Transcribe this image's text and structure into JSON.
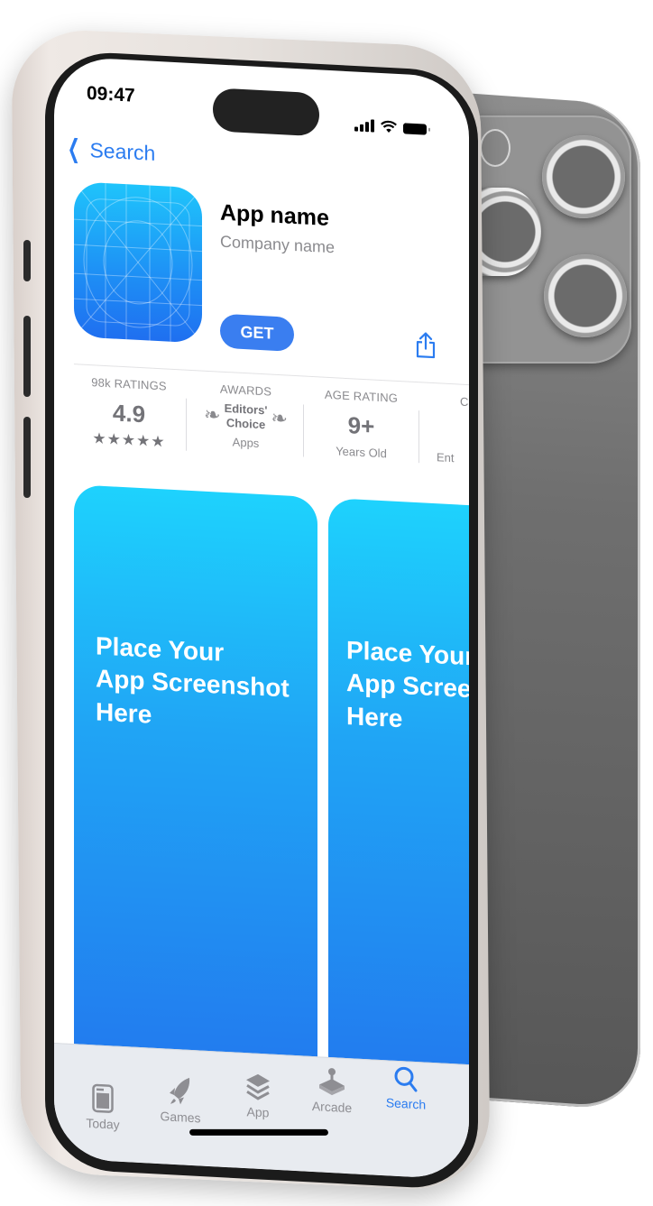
{
  "status_bar": {
    "time": "09:47"
  },
  "nav": {
    "back_label": "Search"
  },
  "app": {
    "name": "App name",
    "company": "Company name",
    "get_label": "GET"
  },
  "info_strip": [
    {
      "label": "98k RATINGS",
      "value": "4.9",
      "sub": "★★★★★",
      "rating": 5
    },
    {
      "label": "AWARDS",
      "value_line1": "Editors'",
      "value_line2": "Choice",
      "sub": "Apps"
    },
    {
      "label": "AGE RATING",
      "value": "9+",
      "sub": "Years Old"
    },
    {
      "label": "C",
      "sub": "Ent"
    }
  ],
  "screenshots": [
    {
      "caption_line1": "Place Your",
      "caption_line2": "App Screenshot",
      "caption_line3": "Here"
    },
    {
      "caption_line1": "Place Your",
      "caption_line2": "App Screenshot",
      "caption_line3": "Here"
    }
  ],
  "tabbar": {
    "items": [
      {
        "label": "Today",
        "icon": "today-icon",
        "active": false
      },
      {
        "label": "Games",
        "icon": "rocket-icon",
        "active": false
      },
      {
        "label": "App",
        "icon": "layers-icon",
        "active": false
      },
      {
        "label": "Arcade",
        "icon": "joystick-icon",
        "active": false
      },
      {
        "label": "Search",
        "icon": "search-icon",
        "active": true
      }
    ]
  },
  "colors": {
    "accent": "#2b7cf0",
    "get_button": "#3a7ef0",
    "card_top": "#1ed2fd",
    "card_bottom": "#2278ee",
    "secondary_text": "#8a8a8e"
  }
}
